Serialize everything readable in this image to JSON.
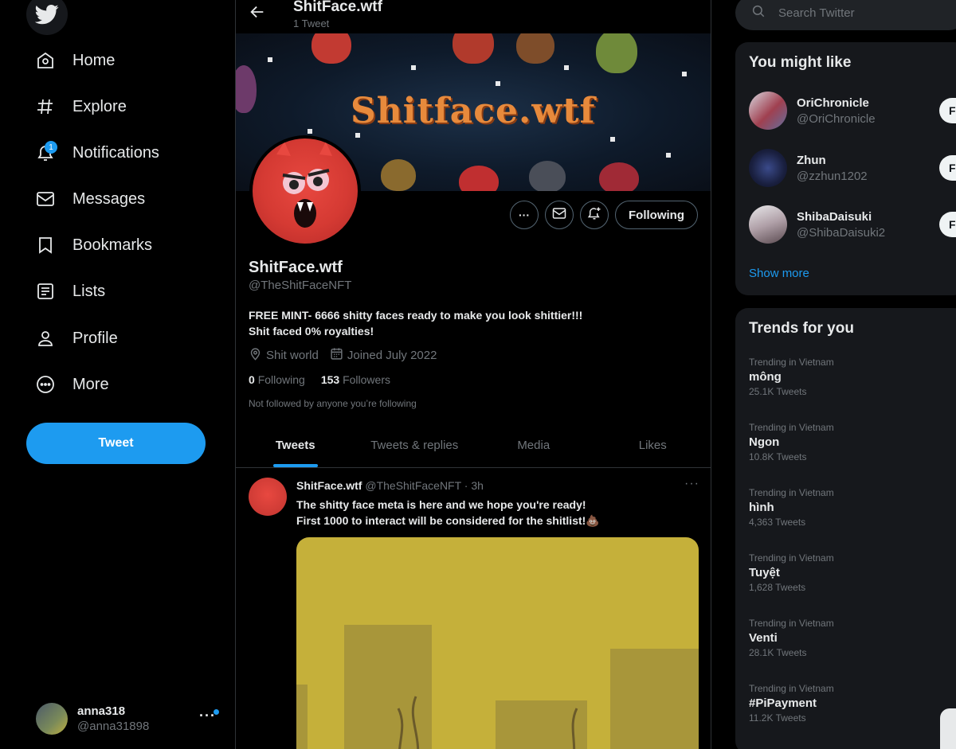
{
  "sidebar": {
    "items": [
      {
        "label": "Home",
        "icon": "home-icon"
      },
      {
        "label": "Explore",
        "icon": "hash-icon"
      },
      {
        "label": "Notifications",
        "icon": "bell-icon",
        "badge": "1"
      },
      {
        "label": "Messages",
        "icon": "mail-icon"
      },
      {
        "label": "Bookmarks",
        "icon": "bookmark-icon"
      },
      {
        "label": "Lists",
        "icon": "list-icon"
      },
      {
        "label": "Profile",
        "icon": "user-icon"
      },
      {
        "label": "More",
        "icon": "more-circle-icon"
      }
    ],
    "tweet_button": "Tweet",
    "account": {
      "name": "anna318",
      "handle": "@anna31898",
      "more": "···"
    }
  },
  "header": {
    "title": "ShitFace.wtf",
    "subtitle": "1 Tweet"
  },
  "banner": {
    "text": "Shitface.wtf"
  },
  "profile": {
    "name": "ShitFace.wtf",
    "handle": "@TheShitFaceNFT",
    "bio_line1": "FREE MINT- 6666 shitty faces ready to make you look shittier!!!",
    "bio_line2": "Shit faced 0% royalties!",
    "location": "Shit world",
    "joined": "Joined July 2022",
    "following_count": "0",
    "following_label": "Following",
    "followers_count": "153",
    "followers_label": "Followers",
    "not_followed_note": "Not followed by anyone you’re following",
    "following_button": "Following",
    "more_button": "···"
  },
  "tabs": [
    {
      "label": "Tweets",
      "active": true
    },
    {
      "label": "Tweets & replies",
      "active": false
    },
    {
      "label": "Media",
      "active": false
    },
    {
      "label": "Likes",
      "active": false
    }
  ],
  "tweet": {
    "name": "ShitFace.wtf",
    "handle_time": "@TheShitFaceNFT · 3h",
    "line1": "The shitty face meta is here and we hope you're ready!",
    "line2": "First 1000 to interact will be considered for the shitlist!💩",
    "more": "···"
  },
  "search": {
    "placeholder": "Search Twitter"
  },
  "you_might_like": {
    "title": "You might like",
    "users": [
      {
        "name": "OriChronicle",
        "handle": "@OriChronicle",
        "follow": "F"
      },
      {
        "name": "Zhun",
        "handle": "@zzhun1202",
        "follow": "F"
      },
      {
        "name": "ShibaDaisuki",
        "handle": "@ShibaDaisuki2",
        "follow": "F"
      }
    ],
    "show_more": "Show more"
  },
  "trends": {
    "title": "Trends for you",
    "items": [
      {
        "context": "Trending in Vietnam",
        "topic": "mông",
        "count": "25.1K Tweets"
      },
      {
        "context": "Trending in Vietnam",
        "topic": "Ngon",
        "count": "10.8K Tweets"
      },
      {
        "context": "Trending in Vietnam",
        "topic": "hình",
        "count": "4,363 Tweets"
      },
      {
        "context": "Trending in Vietnam",
        "topic": "Tuyệt",
        "count": "1,628 Tweets"
      },
      {
        "context": "Trending in Vietnam",
        "topic": "Venti",
        "count": "28.1K Tweets"
      },
      {
        "context": "Trending in Vietnam",
        "topic": "#PiPayment",
        "count": "11.2K Tweets"
      }
    ]
  },
  "colors": {
    "accent": "#1d9bf0",
    "background": "#000000",
    "card": "#16181c",
    "muted_text": "#71767b"
  }
}
